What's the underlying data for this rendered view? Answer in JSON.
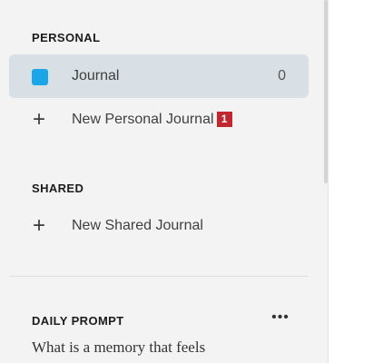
{
  "sidebar": {
    "personal": {
      "heading": "PERSONAL",
      "journal": {
        "label": "Journal",
        "count": "0",
        "color": "#1aa6e8"
      },
      "new_label": "New Personal Journal",
      "new_badge": "1"
    },
    "shared": {
      "heading": "SHARED",
      "new_label": "New Shared Journal"
    },
    "daily_prompt": {
      "heading": "DAILY PROMPT",
      "more": "•••",
      "text": "What is a memory that feels"
    }
  }
}
